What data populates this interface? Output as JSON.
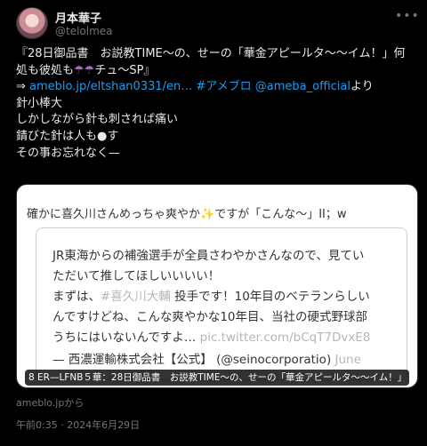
{
  "author": {
    "name": "月本華子",
    "handle": "@telolmea",
    "more_glyph": "•••"
  },
  "tweet": {
    "line1": "『28日御品書　お説教TIME〜の、せーの「華金アピールタ〜〜イム！」何",
    "line2_text": "処も彼処も",
    "line2_umbrellas": "☂☂",
    "line2_rest": "チュ〜SP』",
    "line3_arrow": "⇒ ",
    "line3_link": "ameblo.jp/eltshan0331/en…",
    "line3_hashtag": "#アメブロ",
    "line3_mention": "@ameba_official",
    "line3_tail": "より",
    "line4": "針小棒大",
    "line5": "しかしながら針も刺されば痛い",
    "line6": "錆びた針は人も●す",
    "line7": "その事お忘れなく—"
  },
  "card": {
    "top_text_a": "確かに喜久川さんめっちゃ爽やか",
    "top_sparkle": "✨",
    "top_text_b": "ですが「こんな〜」II；w",
    "quote_line1": "JR東海からの補強選手が全員さわやかさんなので、見てい",
    "quote_line2": "ただいて推してほしいいいい！",
    "quote_line3_a": "まずは、",
    "quote_line3_tag": "#喜久川大輔",
    "quote_line3_b": " 投手です！10年目のベテランらしい",
    "quote_line4": "んですけどね、こんな爽やかな10年目、当社の硬式野球部",
    "quote_line5_a": "うちにはいないんですよ… ",
    "quote_line5_link": "pic.twitter.com/bCqT7DvxE8",
    "author_text": "— 西濃運輸株式会社【公式】 (@seinocorporatio) ",
    "author_date": "June",
    "overlay_text": "8 ER—LFNB５華：28日御品書　お説教TIME〜の、せーの「華金アピールタ〜〜イム！」"
  },
  "source": "ameblo.jpから",
  "timestamp": "午前0:35 · 2024年6月29日",
  "colors": {
    "background": "#000000",
    "text": "#e7e9ea",
    "secondary": "#71767b",
    "link": "#1d9bf0"
  }
}
